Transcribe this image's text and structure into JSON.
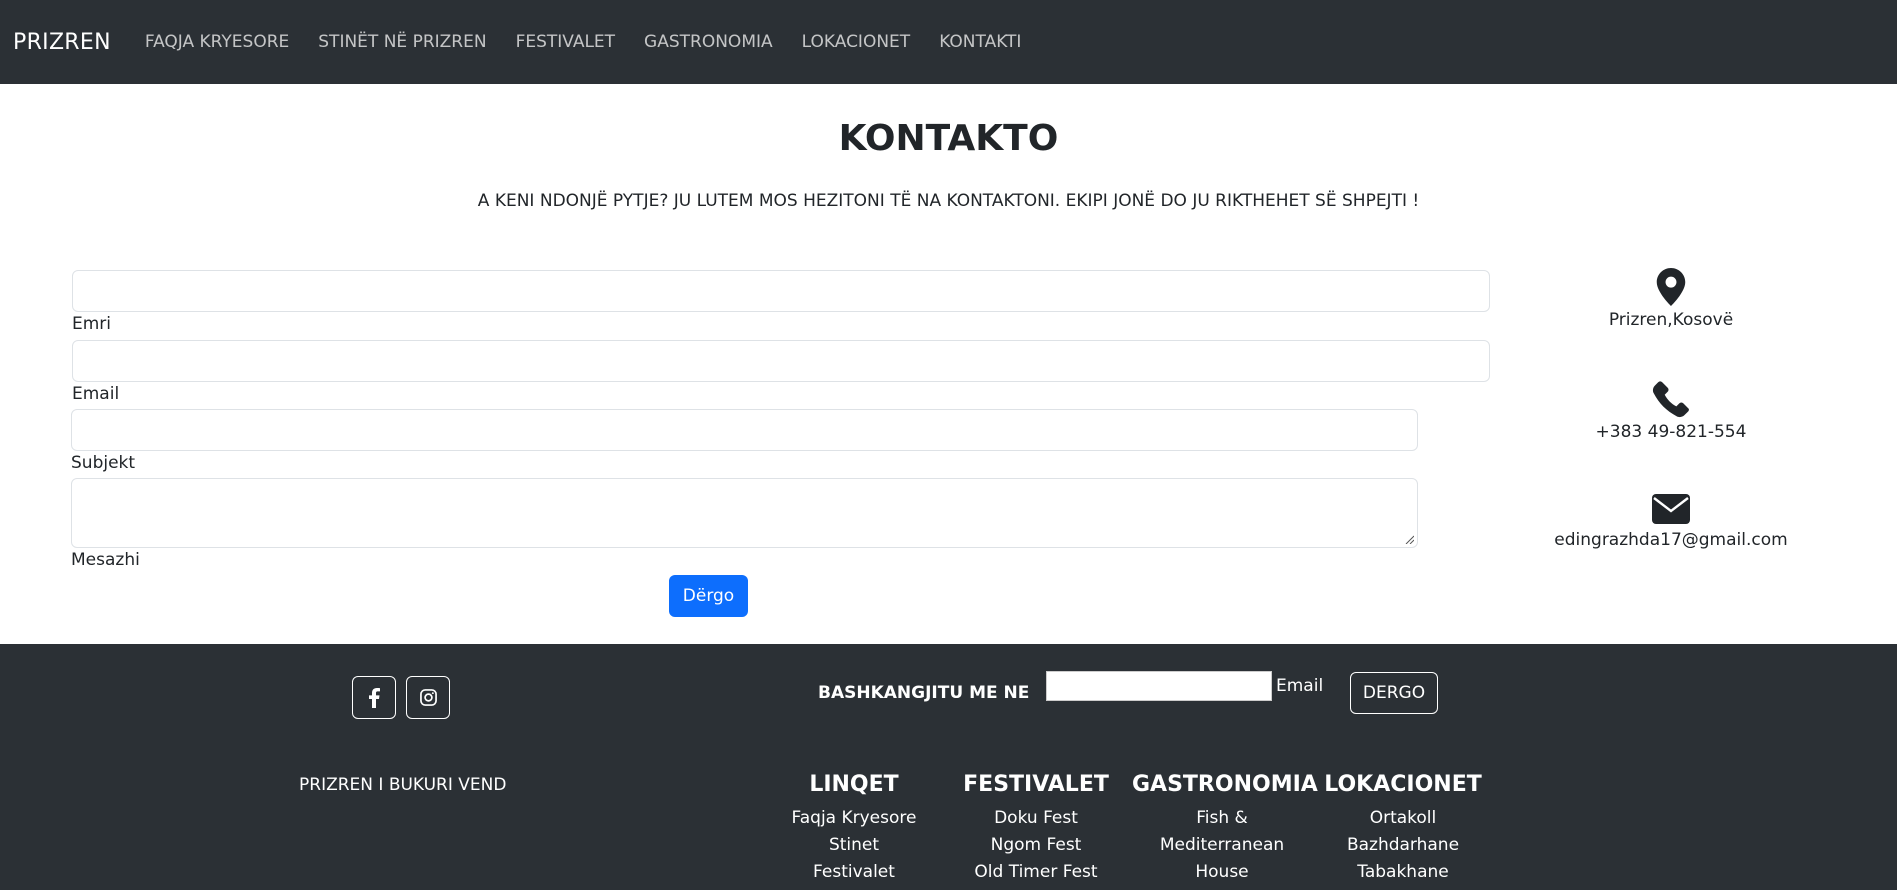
{
  "navbar": {
    "brand": "PRIZREN",
    "links": [
      "FAQJA KRYESORE",
      "STINËT NË PRIZREN",
      "FESTIVALET",
      "GASTRONOMIA",
      "LOKACIONET",
      "KONTAKTI"
    ]
  },
  "page": {
    "title": "KONTAKTO",
    "subtitle": "A KENI NDONJË PYTJE? JU LUTEM MOS HEZITONI TË NA KONTAKTONI. EKIPI JONË DO JU RIKTHEHET SË SHPEJTI !"
  },
  "form": {
    "name_label": "Emri",
    "email_label": "Email",
    "subject_label": "Subjekt",
    "message_label": "Mesazhi",
    "submit_label": "Dërgo"
  },
  "contact_info": {
    "location": "Prizren,Kosovë",
    "phone": "+383 49-821-554",
    "email": "edingrazhda17@gmail.com"
  },
  "footer": {
    "join_label": "BASHKANGJITU ME NE",
    "subscribe_input_label": "Email",
    "subscribe_button": "DERGO",
    "tagline": "PRIZREN I BUKURI VEND",
    "columns": [
      {
        "title": "LINQET",
        "items": [
          "Faqja Kryesore",
          "Stinet",
          "Festivalet"
        ]
      },
      {
        "title": "FESTIVALET",
        "items": [
          "Doku Fest",
          "Ngom Fest",
          "Old Timer Fest"
        ]
      },
      {
        "title": "GASTRONOMIA",
        "items": [
          "Fish &",
          "Mediterranean",
          "House"
        ]
      },
      {
        "title": "LOKACIONET",
        "items": [
          "Ortakoll",
          "Bazhdarhane",
          "Tabakhane"
        ]
      }
    ]
  },
  "colors": {
    "dark_bg": "#2b3035",
    "primary_button": "#0d6efd",
    "text": "#212529"
  }
}
